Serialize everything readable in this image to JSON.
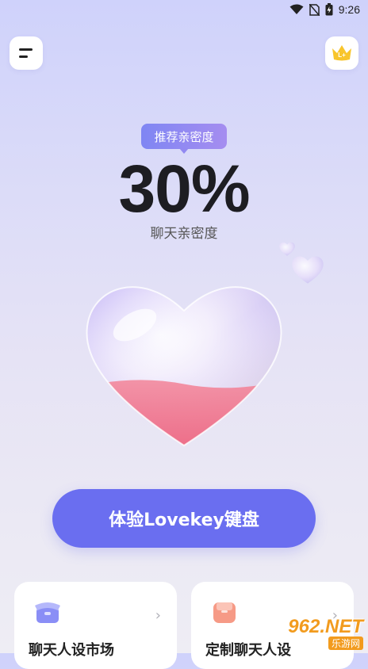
{
  "status_bar": {
    "time": "9:26"
  },
  "header": {
    "menu_icon": "menu-icon",
    "vip_icon": "crown-vip-icon",
    "vip_text": "L+"
  },
  "intimacy": {
    "badge": "推荐亲密度",
    "percent": "30%",
    "percent_value": 30,
    "caption": "聊天亲密度"
  },
  "cta": {
    "label": "体验Lovekey键盘"
  },
  "cards": [
    {
      "title": "聊天人设市场",
      "icon": "market-box-icon",
      "arrow": "›"
    },
    {
      "title": "定制聊天人设",
      "icon": "custom-persona-icon",
      "arrow": "›"
    }
  ],
  "watermark": {
    "main": "962.NET",
    "sub": "乐游网"
  },
  "colors": {
    "accent": "#6a6ef0",
    "badge": "#8e89f2",
    "heart_fill": "#f26f86"
  }
}
